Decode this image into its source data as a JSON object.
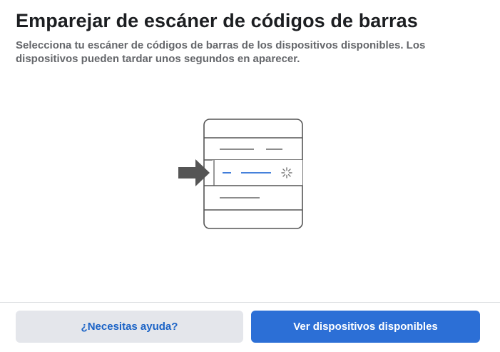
{
  "header": {
    "title": "Emparejar de escáner de códigos de barras",
    "subtitle": "Selecciona tu escáner de códigos de barras de los dispositivos disponibles. Los dispositivos pueden tardar unos segundos en aparecer."
  },
  "illustration": {
    "icons": [
      "arrow-right-icon",
      "loading-spinner-icon",
      "device-list-icon"
    ],
    "colors": {
      "outline": "#555555",
      "arrow": "#555555",
      "highlight_line": "#2c6fd6",
      "spinner": "#777777"
    }
  },
  "footer": {
    "help_label": "¿Necesitas ayuda?",
    "primary_label": "Ver dispositivos disponibles"
  },
  "colors": {
    "primary_button": "#2c6fd6",
    "secondary_button": "#e4e6eb",
    "link_text": "#1b63c6",
    "title_text": "#1c1e21",
    "subtitle_text": "#65676b"
  }
}
